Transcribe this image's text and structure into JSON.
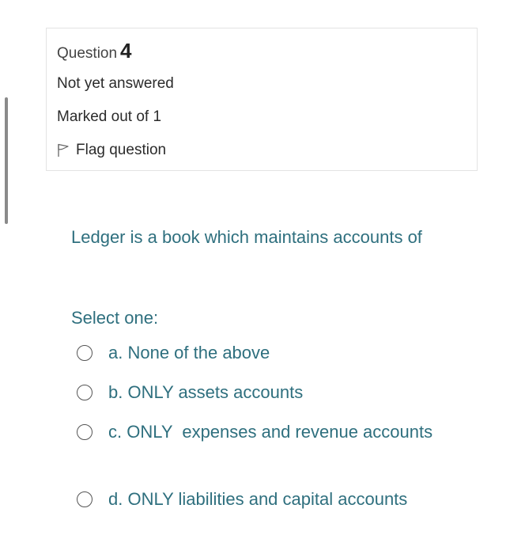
{
  "info": {
    "question_label": "Question",
    "question_number": "4",
    "state": "Not yet answered",
    "grade": "Marked out of 1",
    "flag_label": "Flag question"
  },
  "question": {
    "text": "Ledger is a book which maintains accounts of",
    "prompt": "Select one:",
    "options": [
      {
        "label": "a. None of the above"
      },
      {
        "label": "b. ONLY assets accounts"
      },
      {
        "label": "c. ONLY  expenses and revenue accounts"
      },
      {
        "label": "d. ONLY liabilities and capital accounts"
      }
    ]
  },
  "colors": {
    "question_text": "#2e6f7e",
    "info_border": "#e3e3e3"
  }
}
